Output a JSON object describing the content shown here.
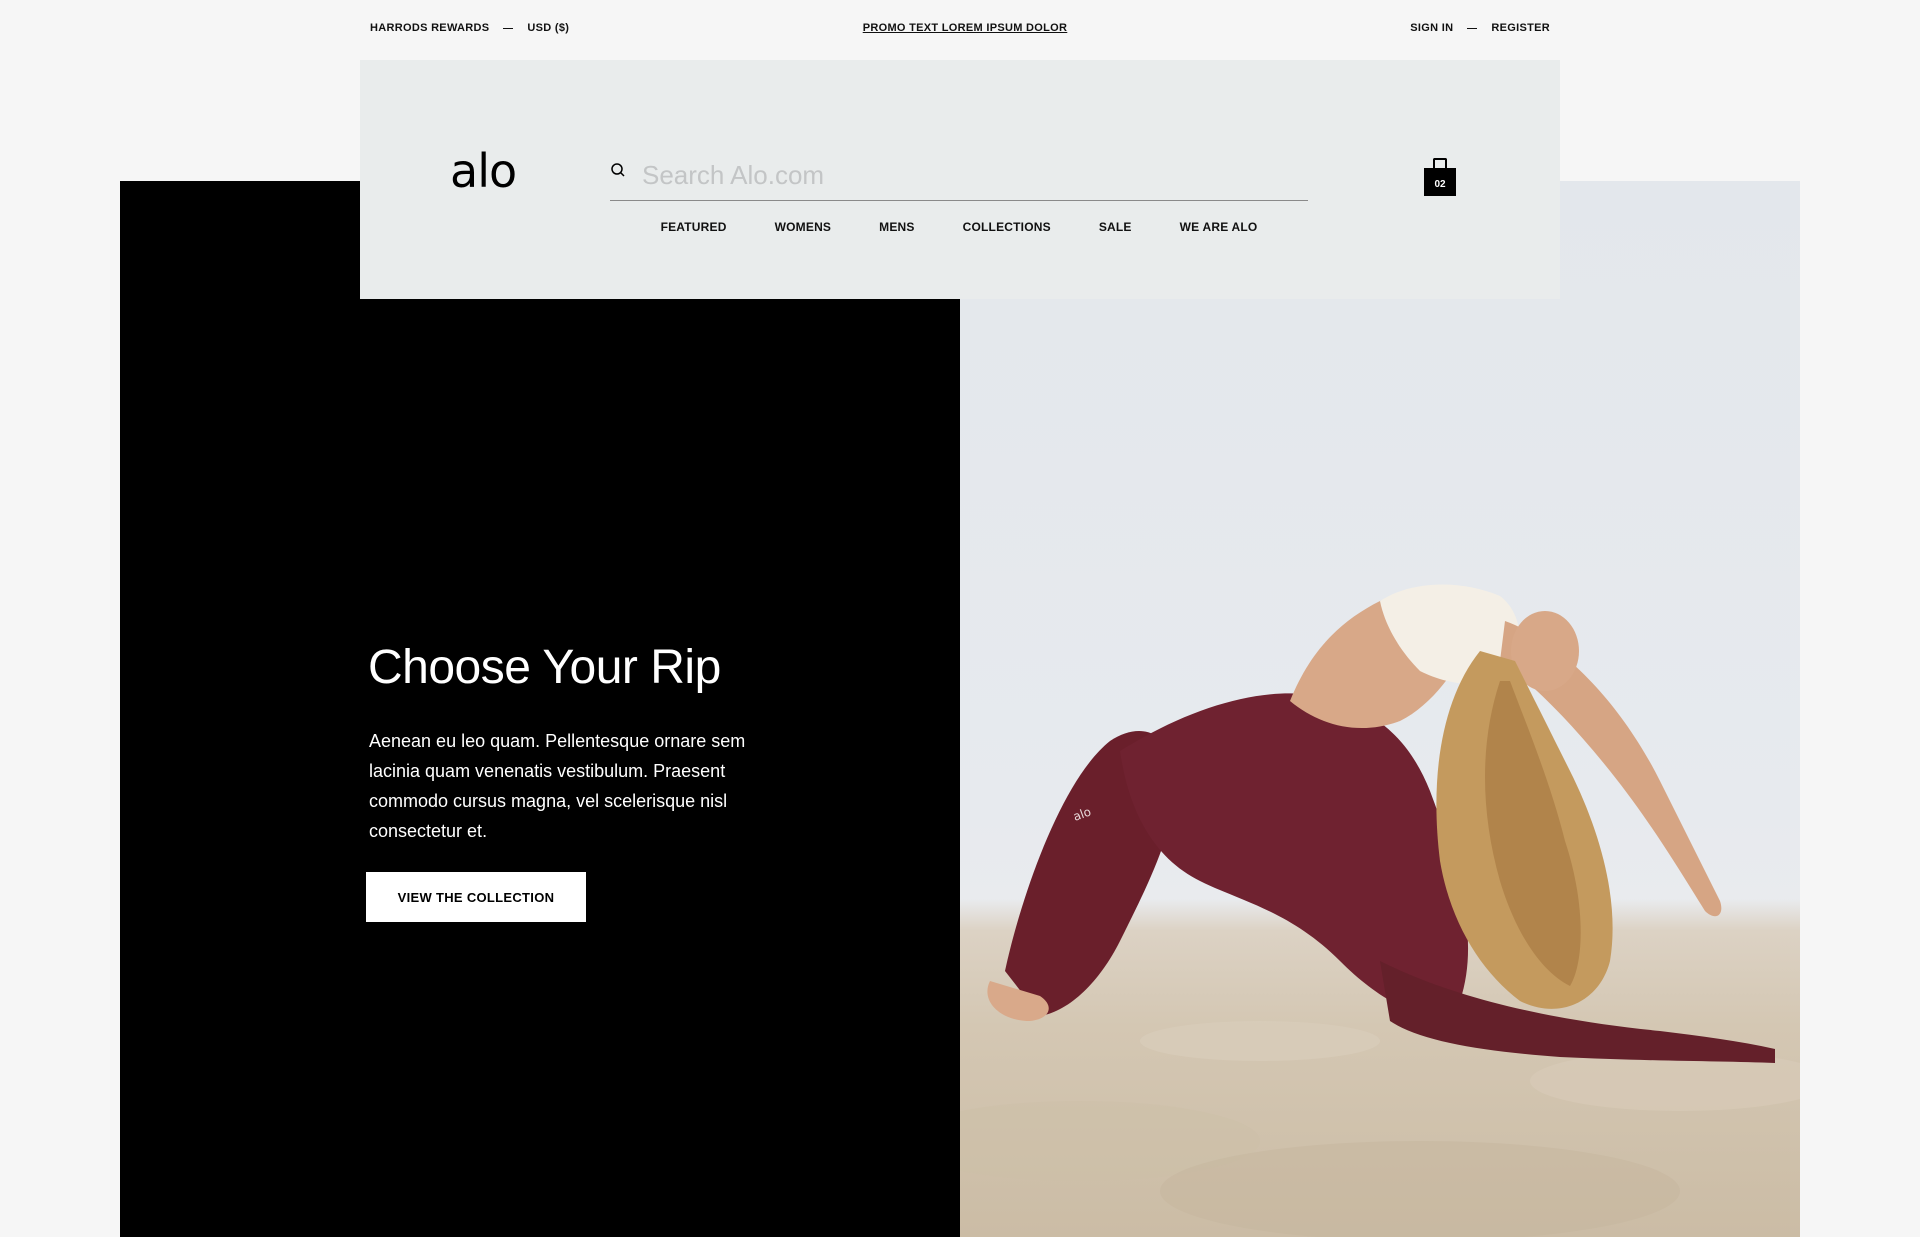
{
  "utility_bar": {
    "rewards_label": "HARRODS REWARDS",
    "currency_label": "USD ($)",
    "promo_text": "PROMO TEXT LOREM IPSUM DOLOR",
    "sign_in_label": "SIGN IN",
    "register_label": "REGISTER"
  },
  "header": {
    "logo_text": "alo",
    "search": {
      "placeholder": "Search Alo.com",
      "value": ""
    },
    "nav_items": [
      {
        "label": "FEATURED"
      },
      {
        "label": "WOMENS"
      },
      {
        "label": "MENS"
      },
      {
        "label": "COLLECTIONS"
      },
      {
        "label": "SALE"
      },
      {
        "label": "WE ARE ALO"
      }
    ],
    "bag": {
      "count": "02",
      "icon": "shopping-bag-icon"
    }
  },
  "hero": {
    "title": "Choose Your Rip",
    "body": "Aenean eu leo quam. Pellentesque ornare sem lacinia quam venenatis vestibulum. Praesent commodo cursus magna, vel scelerisque nisl consectetur et.",
    "cta_label": "VIEW THE COLLECTION",
    "image_logo_text": "alo"
  },
  "colors": {
    "page_background": "#f6f6f6",
    "header_panel": "#e9ecec",
    "hero_panel": "#000000",
    "leggings": "#6a1f2b",
    "sand": "#d4c7b3",
    "sky": "#e3e7ec"
  }
}
